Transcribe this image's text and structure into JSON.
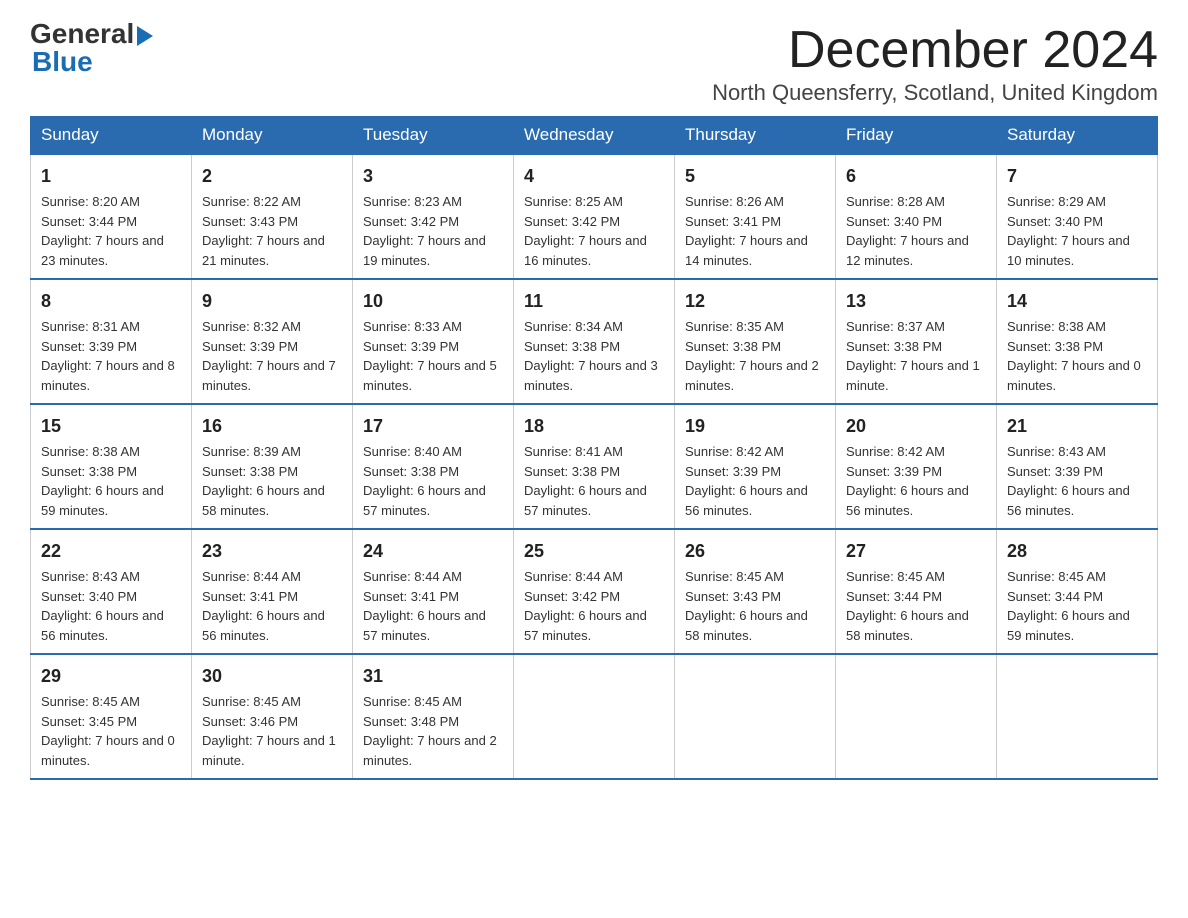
{
  "logo": {
    "text_general": "General",
    "arrow": "▶",
    "text_blue": "Blue"
  },
  "title": "December 2024",
  "subtitle": "North Queensferry, Scotland, United Kingdom",
  "header_days": [
    "Sunday",
    "Monday",
    "Tuesday",
    "Wednesday",
    "Thursday",
    "Friday",
    "Saturday"
  ],
  "weeks": [
    [
      {
        "day": "1",
        "sunrise": "8:20 AM",
        "sunset": "3:44 PM",
        "daylight": "7 hours and 23 minutes."
      },
      {
        "day": "2",
        "sunrise": "8:22 AM",
        "sunset": "3:43 PM",
        "daylight": "7 hours and 21 minutes."
      },
      {
        "day": "3",
        "sunrise": "8:23 AM",
        "sunset": "3:42 PM",
        "daylight": "7 hours and 19 minutes."
      },
      {
        "day": "4",
        "sunrise": "8:25 AM",
        "sunset": "3:42 PM",
        "daylight": "7 hours and 16 minutes."
      },
      {
        "day": "5",
        "sunrise": "8:26 AM",
        "sunset": "3:41 PM",
        "daylight": "7 hours and 14 minutes."
      },
      {
        "day": "6",
        "sunrise": "8:28 AM",
        "sunset": "3:40 PM",
        "daylight": "7 hours and 12 minutes."
      },
      {
        "day": "7",
        "sunrise": "8:29 AM",
        "sunset": "3:40 PM",
        "daylight": "7 hours and 10 minutes."
      }
    ],
    [
      {
        "day": "8",
        "sunrise": "8:31 AM",
        "sunset": "3:39 PM",
        "daylight": "7 hours and 8 minutes."
      },
      {
        "day": "9",
        "sunrise": "8:32 AM",
        "sunset": "3:39 PM",
        "daylight": "7 hours and 7 minutes."
      },
      {
        "day": "10",
        "sunrise": "8:33 AM",
        "sunset": "3:39 PM",
        "daylight": "7 hours and 5 minutes."
      },
      {
        "day": "11",
        "sunrise": "8:34 AM",
        "sunset": "3:38 PM",
        "daylight": "7 hours and 3 minutes."
      },
      {
        "day": "12",
        "sunrise": "8:35 AM",
        "sunset": "3:38 PM",
        "daylight": "7 hours and 2 minutes."
      },
      {
        "day": "13",
        "sunrise": "8:37 AM",
        "sunset": "3:38 PM",
        "daylight": "7 hours and 1 minute."
      },
      {
        "day": "14",
        "sunrise": "8:38 AM",
        "sunset": "3:38 PM",
        "daylight": "7 hours and 0 minutes."
      }
    ],
    [
      {
        "day": "15",
        "sunrise": "8:38 AM",
        "sunset": "3:38 PM",
        "daylight": "6 hours and 59 minutes."
      },
      {
        "day": "16",
        "sunrise": "8:39 AM",
        "sunset": "3:38 PM",
        "daylight": "6 hours and 58 minutes."
      },
      {
        "day": "17",
        "sunrise": "8:40 AM",
        "sunset": "3:38 PM",
        "daylight": "6 hours and 57 minutes."
      },
      {
        "day": "18",
        "sunrise": "8:41 AM",
        "sunset": "3:38 PM",
        "daylight": "6 hours and 57 minutes."
      },
      {
        "day": "19",
        "sunrise": "8:42 AM",
        "sunset": "3:39 PM",
        "daylight": "6 hours and 56 minutes."
      },
      {
        "day": "20",
        "sunrise": "8:42 AM",
        "sunset": "3:39 PM",
        "daylight": "6 hours and 56 minutes."
      },
      {
        "day": "21",
        "sunrise": "8:43 AM",
        "sunset": "3:39 PM",
        "daylight": "6 hours and 56 minutes."
      }
    ],
    [
      {
        "day": "22",
        "sunrise": "8:43 AM",
        "sunset": "3:40 PM",
        "daylight": "6 hours and 56 minutes."
      },
      {
        "day": "23",
        "sunrise": "8:44 AM",
        "sunset": "3:41 PM",
        "daylight": "6 hours and 56 minutes."
      },
      {
        "day": "24",
        "sunrise": "8:44 AM",
        "sunset": "3:41 PM",
        "daylight": "6 hours and 57 minutes."
      },
      {
        "day": "25",
        "sunrise": "8:44 AM",
        "sunset": "3:42 PM",
        "daylight": "6 hours and 57 minutes."
      },
      {
        "day": "26",
        "sunrise": "8:45 AM",
        "sunset": "3:43 PM",
        "daylight": "6 hours and 58 minutes."
      },
      {
        "day": "27",
        "sunrise": "8:45 AM",
        "sunset": "3:44 PM",
        "daylight": "6 hours and 58 minutes."
      },
      {
        "day": "28",
        "sunrise": "8:45 AM",
        "sunset": "3:44 PM",
        "daylight": "6 hours and 59 minutes."
      }
    ],
    [
      {
        "day": "29",
        "sunrise": "8:45 AM",
        "sunset": "3:45 PM",
        "daylight": "7 hours and 0 minutes."
      },
      {
        "day": "30",
        "sunrise": "8:45 AM",
        "sunset": "3:46 PM",
        "daylight": "7 hours and 1 minute."
      },
      {
        "day": "31",
        "sunrise": "8:45 AM",
        "sunset": "3:48 PM",
        "daylight": "7 hours and 2 minutes."
      },
      null,
      null,
      null,
      null
    ]
  ],
  "sunrise_label": "Sunrise:",
  "sunset_label": "Sunset:",
  "daylight_label": "Daylight:"
}
